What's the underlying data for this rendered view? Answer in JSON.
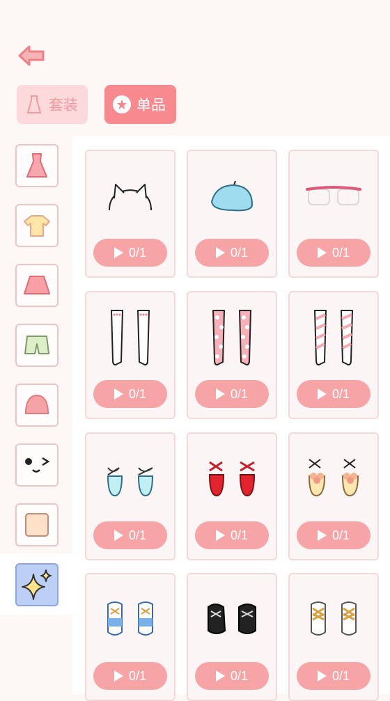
{
  "tabs": [
    {
      "label": "套装",
      "icon": "dress-icon"
    },
    {
      "label": "单品",
      "icon": "star-icon"
    }
  ],
  "categories": [
    {
      "name": "dress",
      "icon": "dress-icon"
    },
    {
      "name": "top",
      "icon": "shirt-icon"
    },
    {
      "name": "skirt",
      "icon": "skirt-icon"
    },
    {
      "name": "shorts",
      "icon": "shorts-icon"
    },
    {
      "name": "hair",
      "icon": "hair-icon"
    },
    {
      "name": "face",
      "icon": "face-icon"
    },
    {
      "name": "skin",
      "icon": "skin-swatch-icon"
    },
    {
      "name": "accessories",
      "icon": "sparkle-icon",
      "active": true
    }
  ],
  "items": [
    {
      "icon": "cat-ear-headband-icon",
      "progress": "0/1"
    },
    {
      "icon": "blue-beret-icon",
      "progress": "0/1"
    },
    {
      "icon": "glasses-icon",
      "progress": "0/1"
    },
    {
      "icon": "white-stockings-icon",
      "progress": "0/1"
    },
    {
      "icon": "polka-dot-stockings-icon",
      "progress": "0/1"
    },
    {
      "icon": "striped-stockings-icon",
      "progress": "0/1"
    },
    {
      "icon": "blue-ballet-shoes-icon",
      "progress": "0/1"
    },
    {
      "icon": "red-ballet-shoes-icon",
      "progress": "0/1"
    },
    {
      "icon": "flower-sandals-icon",
      "progress": "0/1"
    },
    {
      "icon": "blue-sneakers-icon",
      "progress": "0/1"
    },
    {
      "icon": "black-boots-icon",
      "progress": "0/1"
    },
    {
      "icon": "white-sneakers-icon",
      "progress": "0/1"
    }
  ],
  "colors": {
    "accent": "#f7898f",
    "active_category": "#bcd0f6"
  }
}
